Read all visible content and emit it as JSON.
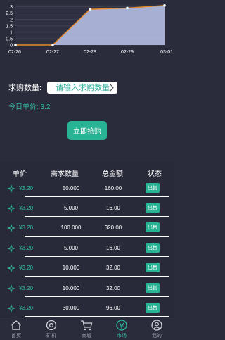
{
  "chart_data": {
    "type": "area",
    "x": [
      "02-26",
      "02-27",
      "02-28",
      "02-29",
      "03-01"
    ],
    "values": [
      0,
      0,
      2.8,
      2.9,
      3.1
    ],
    "yticks": [
      "3",
      "2.5",
      "2",
      "1.5",
      "1",
      "0.5",
      "0"
    ],
    "ylim": [
      0,
      3.2
    ],
    "grid": true,
    "line_color": "#e88a2b",
    "fill_color": "#b5bfe3",
    "marker_color": "#ffffff"
  },
  "form": {
    "qty_label": "求购数量:",
    "qty_placeholder": "请输入求购数量",
    "price_label": "今日单价: 3.2",
    "buy_button": "立即抢购"
  },
  "table": {
    "headers": [
      "单价",
      "需求数量",
      "总金额",
      "状态"
    ],
    "rows": [
      {
        "unit": "¥3.20",
        "qty": "50.000",
        "total": "160.00",
        "status": "出售"
      },
      {
        "unit": "¥3.20",
        "qty": "5.000",
        "total": "16.00",
        "status": "出售"
      },
      {
        "unit": "¥3.20",
        "qty": "100.000",
        "total": "320.00",
        "status": "出售"
      },
      {
        "unit": "¥3.20",
        "qty": "5.000",
        "total": "16.00",
        "status": "出售"
      },
      {
        "unit": "¥3.20",
        "qty": "10.000",
        "total": "32.00",
        "status": "出售"
      },
      {
        "unit": "¥3.20",
        "qty": "10.000",
        "total": "32.00",
        "status": "出售"
      },
      {
        "unit": "¥3.20",
        "qty": "30.000",
        "total": "96.00",
        "status": "出售"
      }
    ]
  },
  "tabbar": {
    "tabs": [
      {
        "label": "首页",
        "icon": "home-icon",
        "active": false
      },
      {
        "label": "矿机",
        "icon": "miner-icon",
        "active": false
      },
      {
        "label": "商城",
        "icon": "cart-icon",
        "active": false
      },
      {
        "label": "市场",
        "icon": "market-icon",
        "active": true
      },
      {
        "label": "我的",
        "icon": "user-icon",
        "active": false
      }
    ]
  },
  "colors": {
    "accent": "#28b394",
    "background": "#2a2c3c"
  }
}
